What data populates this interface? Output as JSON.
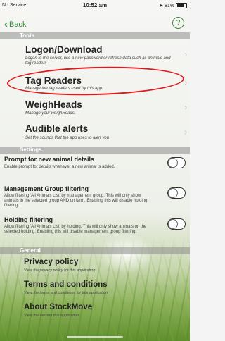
{
  "status": {
    "carrier": "No Service",
    "time": "10:52 am",
    "battery": "81%"
  },
  "nav": {
    "back_label": "Back",
    "help_label": "?"
  },
  "sections": {
    "tools": "Tools",
    "settings": "Settings",
    "general": "General"
  },
  "tools": [
    {
      "title": "Logon/Download",
      "subtitle": "Logon to the server, use a new password or refresh data such as animals and tag readers"
    },
    {
      "title": "Tag Readers",
      "subtitle": "Manage the tag readers used by this app."
    },
    {
      "title": "WeighHeads",
      "subtitle": "Manage your weighHeads."
    },
    {
      "title": "Audible alerts",
      "subtitle": "Set the sounds that the app uses to alert you"
    }
  ],
  "settings": [
    {
      "title": "Prompt for new animal details",
      "subtitle": "Enable prompt for details whenever a new animal is added.",
      "enabled": false
    },
    {
      "title": "Management Group filtering",
      "subtitle": "Allow filtering 'All Animals List' by management group. This will only show animals in the selected group AND on farm. Enabling this will disable holding filtering.",
      "enabled": false
    },
    {
      "title": "Holding filtering",
      "subtitle": "Allow filtering 'All Animals List' by holding. This will only show animals on the selected holding. Enabling this will disable management group filtering.",
      "enabled": false
    }
  ],
  "general": [
    {
      "title": "Privacy policy",
      "subtitle": "View the privacy policy for this application"
    },
    {
      "title": "Terms and conditions",
      "subtitle": "View the terms and conditions for this application"
    },
    {
      "title": "About StockMove",
      "subtitle": "View the version this application"
    }
  ]
}
